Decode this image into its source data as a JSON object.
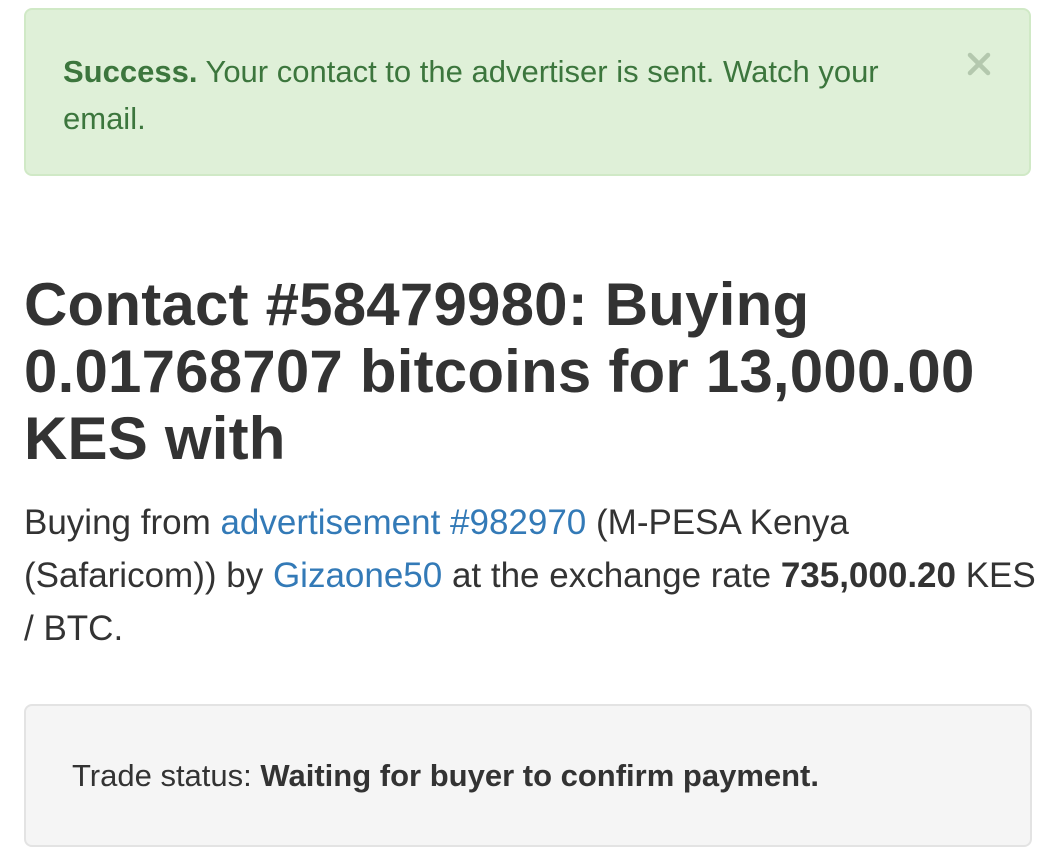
{
  "alert": {
    "title": "Success.",
    "message": " Your contact to the advertiser is sent. Watch your email.",
    "close_label": "×",
    "color": "#3c763d",
    "background": "#dff0d8"
  },
  "contact": {
    "title": "Contact #58479980: Buying 0.01768707 bitcoins for 13,000.00 KES with",
    "intro": "Buying from ",
    "ad_link": "advertisement #982970",
    "method": " (M-PESA Kenya (Safaricom)) by ",
    "trader_link": "Gizaone50",
    "rate_intro": " at the exchange rate ",
    "rate_value": "735,000.20",
    "rate_unit": " KES / BTC.",
    "link_color": "#337ab7"
  },
  "status": {
    "label": "Trade status: ",
    "value": "Waiting for buyer to confirm payment."
  }
}
